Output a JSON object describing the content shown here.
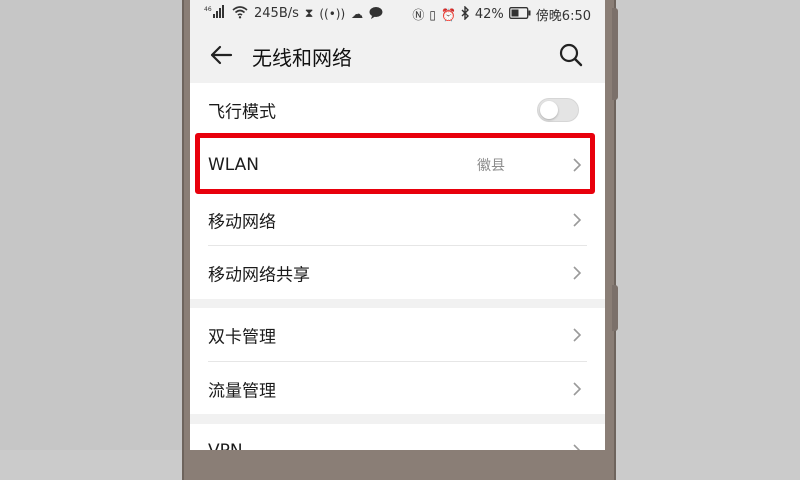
{
  "status_bar": {
    "signal": "⁴⁶",
    "speed": "245B/s",
    "battery_percent": "42%",
    "time": "傍晚6:50"
  },
  "toolbar": {
    "title": "无线和网络"
  },
  "settings": {
    "airplane_mode": {
      "label": "飞行模式",
      "enabled": false
    },
    "wlan": {
      "label": "WLAN",
      "value": "徽县"
    },
    "mobile_network": {
      "label": "移动网络"
    },
    "hotspot": {
      "label": "移动网络共享"
    },
    "dual_sim": {
      "label": "双卡管理"
    },
    "data_usage": {
      "label": "流量管理"
    },
    "vpn": {
      "label": "VPN"
    }
  },
  "colors": {
    "highlight": "#e8000c",
    "background": "#f1f1f1",
    "card": "#ffffff"
  }
}
